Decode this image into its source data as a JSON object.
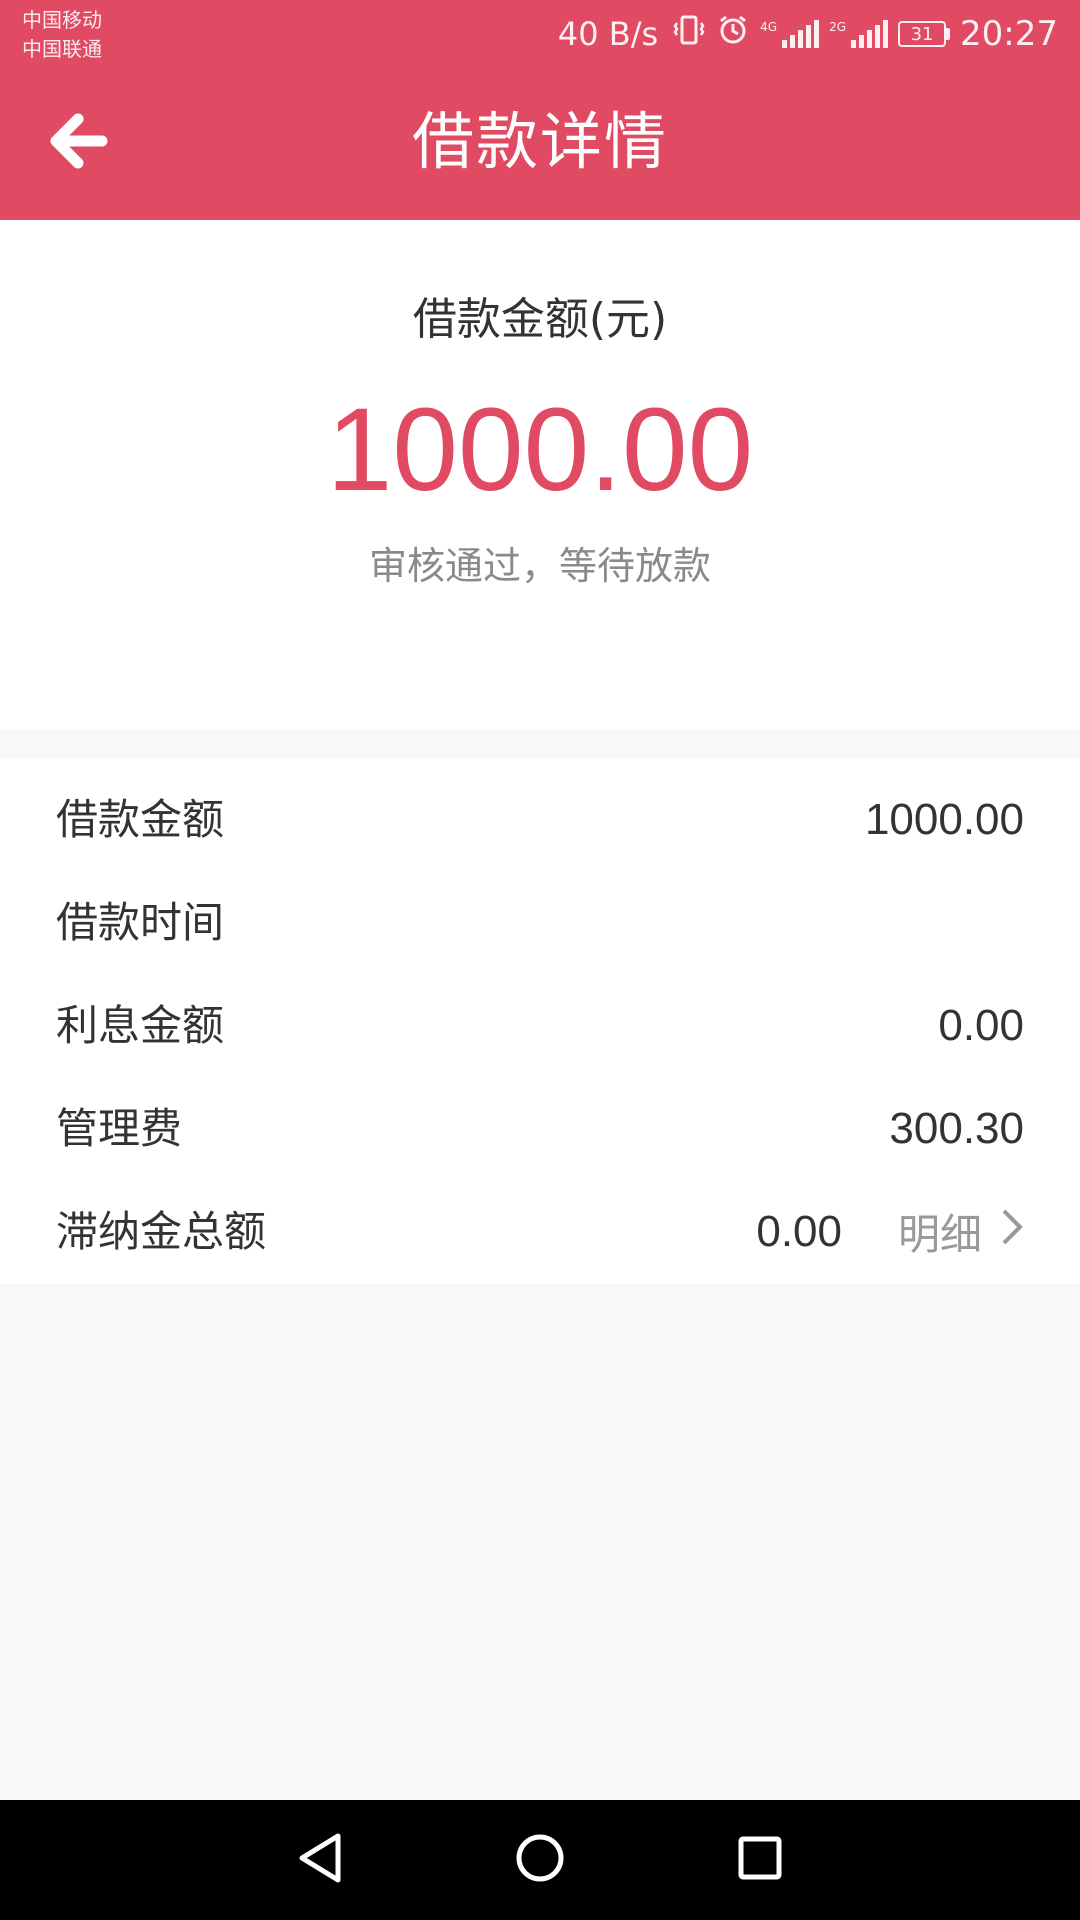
{
  "status_bar": {
    "carrier_1": "中国移动",
    "carrier_2": "中国联通",
    "net_speed": "40 B/s",
    "network_1": "4G",
    "network_2": "2G",
    "battery": "31",
    "time": "20:27",
    "icons": [
      "vibrate-icon",
      "alarm-icon",
      "signal-4g-icon",
      "signal-2g-icon",
      "battery-icon"
    ]
  },
  "header": {
    "title": "借款详情",
    "back_icon": "arrow-left-icon"
  },
  "summary": {
    "label": "借款金额(元)",
    "amount": "1000.00",
    "status": "审核通过，等待放款"
  },
  "details": {
    "rows": [
      {
        "label": "借款金额",
        "value": "1000.00"
      },
      {
        "label": "借款时间",
        "value": ""
      },
      {
        "label": "利息金额",
        "value": "0.00"
      },
      {
        "label": "管理费",
        "value": "300.30"
      },
      {
        "label": "滞纳金总额",
        "value": "0.00",
        "link": "明细",
        "link_icon": "chevron-right-icon"
      }
    ]
  },
  "nav_bar": {
    "buttons": [
      "back-triangle-icon",
      "home-circle-icon",
      "recents-square-icon"
    ]
  },
  "colors": {
    "brand": "#e04a63",
    "text": "#333333",
    "muted": "#8a8a8a",
    "background": "#f8f8f8"
  }
}
